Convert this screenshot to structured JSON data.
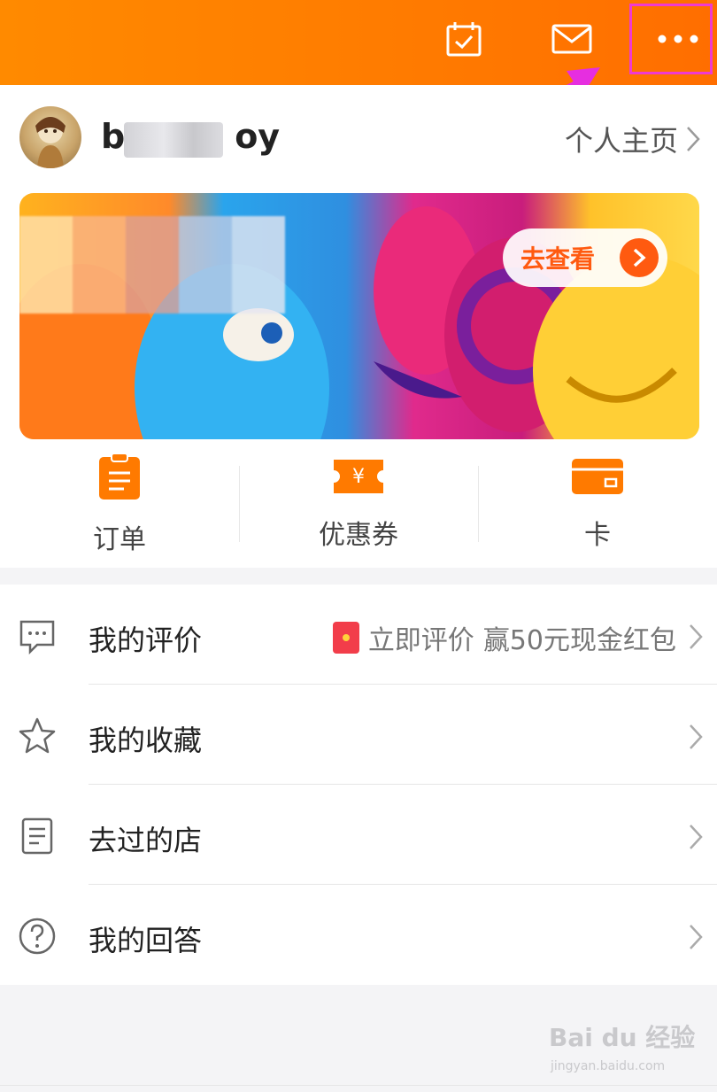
{
  "header": {
    "icons": [
      "calendar-check-icon",
      "mail-icon",
      "more-icon"
    ],
    "bg_color": "#ff7a00"
  },
  "profile": {
    "username_left": "b",
    "username_right": "oy",
    "home_link": "个人主页"
  },
  "banner": {
    "cta": "去查看"
  },
  "shortcuts": [
    {
      "label": "订单",
      "icon": "order-icon"
    },
    {
      "label": "优惠券",
      "icon": "coupon-icon"
    },
    {
      "label": "卡",
      "icon": "card-icon"
    }
  ],
  "list": {
    "reviews": {
      "label": "我的评价",
      "promo_a": "立即评价",
      "promo_b": "赢50元现金红包"
    },
    "favorites": {
      "label": "我的收藏"
    },
    "visited": {
      "label": "去过的店"
    },
    "answers": {
      "label": "我的回答"
    }
  },
  "watermark": {
    "text": "Bai du 经验",
    "sub": "jingyan.baidu.com"
  },
  "colors": {
    "accent": "#ff6e00",
    "highlight": "#f03ad0"
  }
}
